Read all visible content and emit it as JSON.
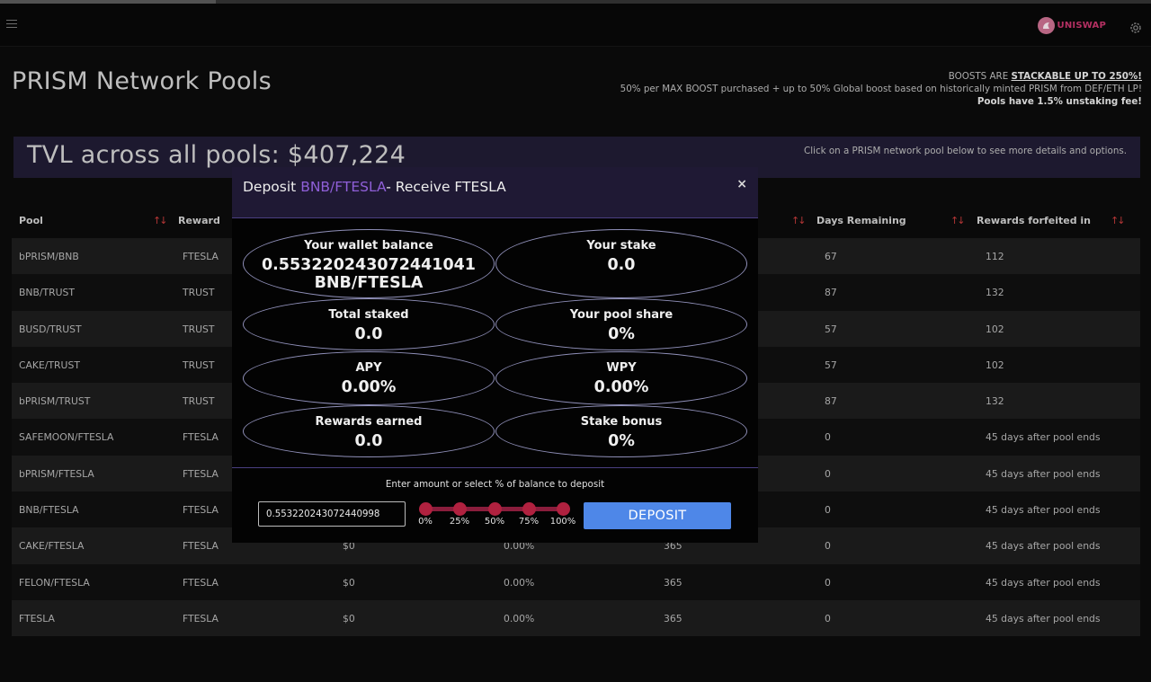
{
  "header": {
    "uniswap_label": "UNISWAP",
    "menu_icon": "hamburger-icon",
    "settings_icon": "gear-icon"
  },
  "page": {
    "title": "PRISM Network Pools"
  },
  "boost_info": {
    "line1_prefix": "BOOSTS ARE ",
    "line1_emphasis": "STACKABLE UP TO 250%!",
    "line2": "50% per MAX BOOST purchased + up to 50% Global boost based on historically minted PRISM from DEF/ETH LP!",
    "line3": "Pools have 1.5% unstaking fee!"
  },
  "tvl": {
    "text": "TVL across all pools: $407,224",
    "hint": "Click on a PRISM network pool below to see more details and options."
  },
  "table": {
    "headers": {
      "pool": "Pool",
      "reward": "Reward",
      "days_remaining": "Days Remaining",
      "rewards_forfeited": "Rewards forfeited in"
    },
    "rows": [
      {
        "pool": "bPRISM/BNB",
        "reward": "FTESLA",
        "tvl": "",
        "apy": "",
        "duration": "",
        "days": "67",
        "forfeit": "112"
      },
      {
        "pool": "BNB/TRUST",
        "reward": "TRUST",
        "tvl": "",
        "apy": "",
        "duration": "",
        "days": "87",
        "forfeit": "132"
      },
      {
        "pool": "BUSD/TRUST",
        "reward": "TRUST",
        "tvl": "",
        "apy": "",
        "duration": "",
        "days": "57",
        "forfeit": "102"
      },
      {
        "pool": "CAKE/TRUST",
        "reward": "TRUST",
        "tvl": "",
        "apy": "",
        "duration": "",
        "days": "57",
        "forfeit": "102"
      },
      {
        "pool": "bPRISM/TRUST",
        "reward": "TRUST",
        "tvl": "",
        "apy": "",
        "duration": "",
        "days": "87",
        "forfeit": "132"
      },
      {
        "pool": "SAFEMOON/FTESLA",
        "reward": "FTESLA",
        "tvl": "",
        "apy": "",
        "duration": "",
        "days": "0",
        "forfeit": "45 days after pool ends"
      },
      {
        "pool": "bPRISM/FTESLA",
        "reward": "FTESLA",
        "tvl": "",
        "apy": "",
        "duration": "",
        "days": "0",
        "forfeit": "45 days after pool ends"
      },
      {
        "pool": "BNB/FTESLA",
        "reward": "FTESLA",
        "tvl": "",
        "apy": "",
        "duration": "",
        "days": "0",
        "forfeit": "45 days after pool ends"
      },
      {
        "pool": "CAKE/FTESLA",
        "reward": "FTESLA",
        "tvl": "$0",
        "apy": "0.00%",
        "duration": "365",
        "days": "0",
        "forfeit": "45 days after pool ends"
      },
      {
        "pool": "FELON/FTESLA",
        "reward": "FTESLA",
        "tvl": "$0",
        "apy": "0.00%",
        "duration": "365",
        "days": "0",
        "forfeit": "45 days after pool ends"
      },
      {
        "pool": "FTESLA",
        "reward": "FTESLA",
        "tvl": "$0",
        "apy": "0.00%",
        "duration": "365",
        "days": "0",
        "forfeit": "45 days after pool ends"
      }
    ]
  },
  "modal": {
    "title_prefix": "Deposit ",
    "title_pair": "BNB/FTESLA",
    "title_suffix": "- Receive FTESLA",
    "close": "×",
    "stats": {
      "wallet_label": "Your wallet balance",
      "wallet_value": "0.553220243072441041",
      "wallet_unit": "BNB/FTESLA",
      "stake_label": "Your stake",
      "stake_value": "0.0",
      "total_label": "Total staked",
      "total_value": "0.0",
      "share_label": "Your pool share",
      "share_value": "0%",
      "apy_label": "APY",
      "apy_value": "0.00%",
      "wpy_label": "WPY",
      "wpy_value": "0.00%",
      "earned_label": "Rewards earned",
      "earned_value": "0.0",
      "bonus_label": "Stake bonus",
      "bonus_value": "0%"
    },
    "enter_hint": "Enter amount or select % of balance to deposit",
    "amount_value": "0.553220243072440998",
    "slider_labels": [
      "0%",
      "25%",
      "50%",
      "75%",
      "100%"
    ],
    "deposit_label": "DEPOSIT"
  }
}
